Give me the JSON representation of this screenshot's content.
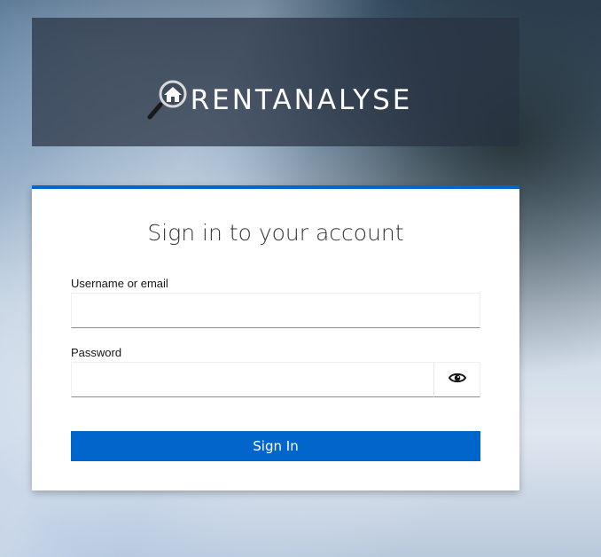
{
  "brand": {
    "name": "RENTANALYSE",
    "logo_icon": "house-magnifier-icon"
  },
  "login": {
    "title": "Sign in to your account",
    "username_label": "Username or email",
    "username_value": "",
    "password_label": "Password",
    "password_value": "",
    "show_password_icon": "eye-icon",
    "submit_label": "Sign In"
  },
  "colors": {
    "primary": "#0066cc",
    "header_overlay": "#28323f",
    "card_background": "#ffffff"
  }
}
